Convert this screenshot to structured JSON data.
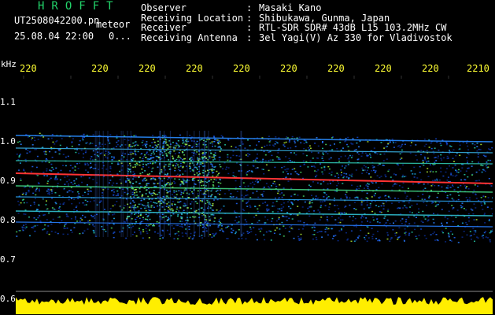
{
  "app": {
    "title": "HROFFT",
    "file_name": "UT2508042200.pn",
    "mode_label": "meteor",
    "date_time": "25.08.04 22:00",
    "mini_value": "0..."
  },
  "info": {
    "rows": [
      {
        "label": "Observer",
        "sep": ":",
        "value": "Masaki Kano"
      },
      {
        "label": "Receiving Location",
        "sep": ":",
        "value": "Shibukawa, Gunma, Japan"
      },
      {
        "label": "Receiver",
        "sep": ":",
        "value": "RTL-SDR SDR# 43dB L15 103.2MHz CW"
      },
      {
        "label": "Receiving Antenna",
        "sep": ":",
        "value": "3el Yagi(V) Az 330 for Vladivostok"
      }
    ]
  },
  "axis": {
    "unit": "kHz",
    "x_ticks": [
      "220",
      "220",
      "220",
      "220",
      "220",
      "220",
      "220",
      "220",
      "220",
      "2210"
    ],
    "y_ticks": [
      "1.1",
      "1.0",
      "0.9",
      "0.8",
      "0.7",
      "0.6"
    ]
  },
  "colors": {
    "background": "#000000",
    "text": "#ffffff",
    "tick_text": "#ffff33",
    "title": "#22d36a",
    "signal_red": "#ff3333",
    "noise_yellow": "#ffee00"
  }
}
